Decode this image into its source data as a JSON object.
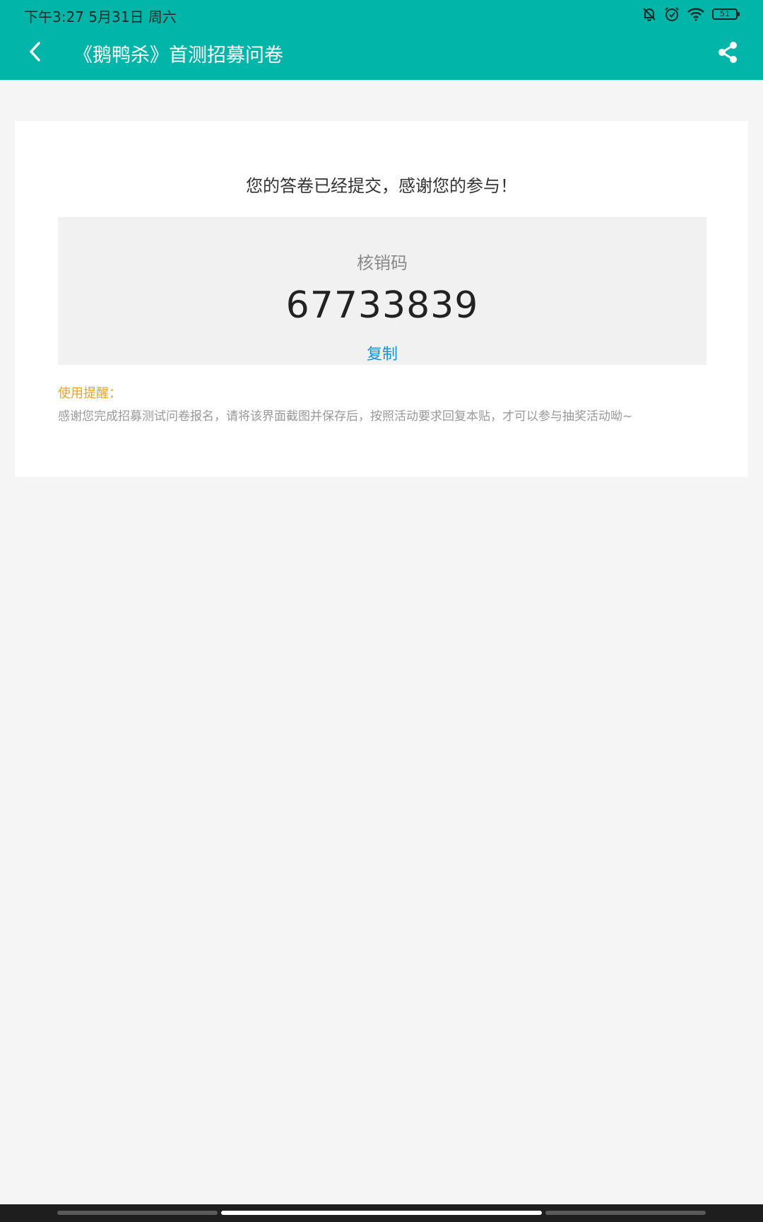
{
  "status_bar": {
    "time": "下午3:27 5月31日 周六",
    "battery_level": "51",
    "icons": [
      "bell-muted-icon",
      "alarm-icon",
      "wifi-icon",
      "battery-icon"
    ]
  },
  "header": {
    "title": "《鹅鸭杀》首测招募问卷",
    "back_icon": "chevron-left-icon",
    "share_icon": "share-icon",
    "background_color": "#01b6a8"
  },
  "result": {
    "message": "您的答卷已经提交，感谢您的参与！",
    "code_label": "核销码",
    "code_value": "67733839",
    "copy_label": "复制"
  },
  "reminder": {
    "title": "使用提醒：",
    "text": "感谢您完成招募测试问卷报名，请将该界面截图并保存后，按照活动要求回复本贴，才可以参与抽奖活动呦~"
  },
  "colors": {
    "accent": "#01b6a8",
    "link": "#1a8fd6",
    "warning": "#f0a020"
  }
}
